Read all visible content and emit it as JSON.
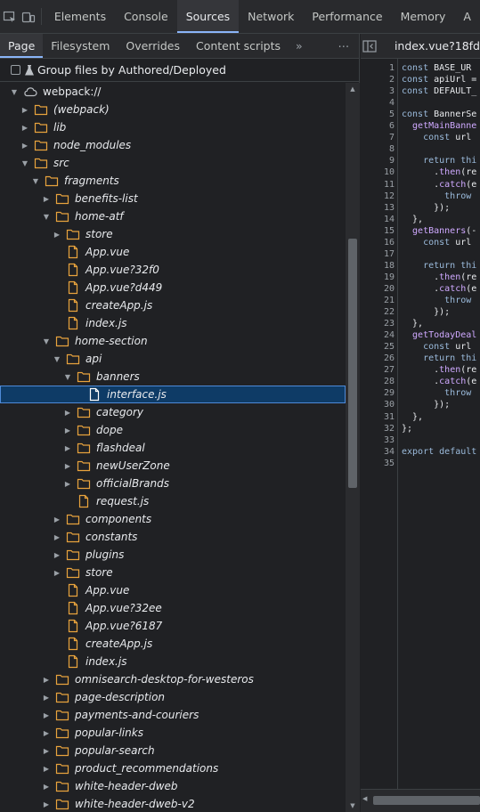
{
  "main_tabs": [
    "Elements",
    "Console",
    "Sources",
    "Network",
    "Performance",
    "Memory",
    "A"
  ],
  "active_main_tab": "Sources",
  "sub_tabs": [
    "Page",
    "Filesystem",
    "Overrides",
    "Content scripts"
  ],
  "sub_tab_more": "»",
  "sub_tab_menu": "⋯",
  "group_label": "Group files by Authored/Deployed",
  "tree": [
    {
      "label": "webpack://",
      "depth": 1,
      "type": "cloud",
      "arrow": "down",
      "italic": false
    },
    {
      "label": "(webpack)",
      "depth": 2,
      "type": "folder",
      "arrow": "right",
      "italic": true
    },
    {
      "label": "lib",
      "depth": 2,
      "type": "folder",
      "arrow": "right",
      "italic": true
    },
    {
      "label": "node_modules",
      "depth": 2,
      "type": "folder",
      "arrow": "right",
      "italic": true
    },
    {
      "label": "src",
      "depth": 2,
      "type": "folder",
      "arrow": "down",
      "italic": true
    },
    {
      "label": "fragments",
      "depth": 3,
      "type": "folder",
      "arrow": "down",
      "italic": true
    },
    {
      "label": "benefits-list",
      "depth": 4,
      "type": "folder",
      "arrow": "right",
      "italic": true
    },
    {
      "label": "home-atf",
      "depth": 4,
      "type": "folder",
      "arrow": "down",
      "italic": true
    },
    {
      "label": "store",
      "depth": 5,
      "type": "folder",
      "arrow": "right",
      "italic": true
    },
    {
      "label": "App.vue",
      "depth": 5,
      "type": "file",
      "arrow": "none",
      "italic": true
    },
    {
      "label": "App.vue?32f0",
      "depth": 5,
      "type": "file",
      "arrow": "none",
      "italic": true
    },
    {
      "label": "App.vue?d449",
      "depth": 5,
      "type": "file",
      "arrow": "none",
      "italic": true
    },
    {
      "label": "createApp.js",
      "depth": 5,
      "type": "file",
      "arrow": "none",
      "italic": true
    },
    {
      "label": "index.js",
      "depth": 5,
      "type": "file",
      "arrow": "none",
      "italic": true
    },
    {
      "label": "home-section",
      "depth": 4,
      "type": "folder",
      "arrow": "down",
      "italic": true
    },
    {
      "label": "api",
      "depth": 5,
      "type": "folder",
      "arrow": "down",
      "italic": true
    },
    {
      "label": "banners",
      "depth": 6,
      "type": "folder",
      "arrow": "down",
      "italic": true
    },
    {
      "label": "interface.js",
      "depth": 7,
      "type": "file-white",
      "arrow": "none",
      "italic": true,
      "selected": true
    },
    {
      "label": "category",
      "depth": 6,
      "type": "folder",
      "arrow": "right",
      "italic": true
    },
    {
      "label": "dope",
      "depth": 6,
      "type": "folder",
      "arrow": "right",
      "italic": true
    },
    {
      "label": "flashdeal",
      "depth": 6,
      "type": "folder",
      "arrow": "right",
      "italic": true
    },
    {
      "label": "newUserZone",
      "depth": 6,
      "type": "folder",
      "arrow": "right",
      "italic": true
    },
    {
      "label": "officialBrands",
      "depth": 6,
      "type": "folder",
      "arrow": "right",
      "italic": true
    },
    {
      "label": "request.js",
      "depth": 6,
      "type": "file",
      "arrow": "none",
      "italic": true
    },
    {
      "label": "components",
      "depth": 5,
      "type": "folder",
      "arrow": "right",
      "italic": true
    },
    {
      "label": "constants",
      "depth": 5,
      "type": "folder",
      "arrow": "right",
      "italic": true
    },
    {
      "label": "plugins",
      "depth": 5,
      "type": "folder",
      "arrow": "right",
      "italic": true
    },
    {
      "label": "store",
      "depth": 5,
      "type": "folder",
      "arrow": "right",
      "italic": true
    },
    {
      "label": "App.vue",
      "depth": 5,
      "type": "file",
      "arrow": "none",
      "italic": true
    },
    {
      "label": "App.vue?32ee",
      "depth": 5,
      "type": "file",
      "arrow": "none",
      "italic": true
    },
    {
      "label": "App.vue?6187",
      "depth": 5,
      "type": "file",
      "arrow": "none",
      "italic": true
    },
    {
      "label": "createApp.js",
      "depth": 5,
      "type": "file",
      "arrow": "none",
      "italic": true
    },
    {
      "label": "index.js",
      "depth": 5,
      "type": "file",
      "arrow": "none",
      "italic": true
    },
    {
      "label": "omnisearch-desktop-for-westeros",
      "depth": 4,
      "type": "folder",
      "arrow": "right",
      "italic": true
    },
    {
      "label": "page-description",
      "depth": 4,
      "type": "folder",
      "arrow": "right",
      "italic": true
    },
    {
      "label": "payments-and-couriers",
      "depth": 4,
      "type": "folder",
      "arrow": "right",
      "italic": true
    },
    {
      "label": "popular-links",
      "depth": 4,
      "type": "folder",
      "arrow": "right",
      "italic": true
    },
    {
      "label": "popular-search",
      "depth": 4,
      "type": "folder",
      "arrow": "right",
      "italic": true
    },
    {
      "label": "product_recommendations",
      "depth": 4,
      "type": "folder",
      "arrow": "right",
      "italic": true
    },
    {
      "label": "white-header-dweb",
      "depth": 4,
      "type": "folder",
      "arrow": "right",
      "italic": true
    },
    {
      "label": "white-header-dweb-v2",
      "depth": 4,
      "type": "folder",
      "arrow": "right",
      "italic": true
    }
  ],
  "editor": {
    "file_tab": "index.vue?18fd",
    "lines": [
      {
        "n": "1",
        "segs": [
          [
            "kw",
            "const "
          ],
          [
            "id",
            "BASE_UR"
          ]
        ]
      },
      {
        "n": "2",
        "segs": [
          [
            "kw",
            "const "
          ],
          [
            "id",
            "apiUrl ="
          ]
        ]
      },
      {
        "n": "3",
        "segs": [
          [
            "kw",
            "const "
          ],
          [
            "id",
            "DEFAULT_"
          ]
        ]
      },
      {
        "n": "4",
        "segs": []
      },
      {
        "n": "5",
        "segs": [
          [
            "kw",
            "const "
          ],
          [
            "id",
            "BannerSe"
          ]
        ]
      },
      {
        "n": "6",
        "segs": [
          [
            "fn",
            "  getMainBanne"
          ]
        ]
      },
      {
        "n": "7",
        "segs": [
          [
            "kw",
            "    const "
          ],
          [
            "id",
            "url"
          ]
        ]
      },
      {
        "n": "8",
        "segs": []
      },
      {
        "n": "9",
        "segs": [
          [
            "kw",
            "    return "
          ],
          [
            "kw",
            "thi"
          ]
        ]
      },
      {
        "n": "10",
        "segs": [
          [
            "id",
            "      ."
          ],
          [
            "fn",
            "then"
          ],
          [
            "id",
            "(re"
          ]
        ]
      },
      {
        "n": "11",
        "segs": [
          [
            "id",
            "      ."
          ],
          [
            "fn",
            "catch"
          ],
          [
            "id",
            "(e"
          ]
        ]
      },
      {
        "n": "12",
        "segs": [
          [
            "kw",
            "        throw"
          ]
        ]
      },
      {
        "n": "13",
        "segs": [
          [
            "id",
            "      });"
          ]
        ]
      },
      {
        "n": "14",
        "segs": [
          [
            "id",
            "  },"
          ]
        ]
      },
      {
        "n": "15",
        "segs": [
          [
            "fn",
            "  getBanners"
          ],
          [
            "id",
            "(-"
          ]
        ]
      },
      {
        "n": "16",
        "segs": [
          [
            "kw",
            "    const "
          ],
          [
            "id",
            "url"
          ]
        ]
      },
      {
        "n": "17",
        "segs": []
      },
      {
        "n": "18",
        "segs": [
          [
            "kw",
            "    return "
          ],
          [
            "kw",
            "thi"
          ]
        ]
      },
      {
        "n": "19",
        "segs": [
          [
            "id",
            "      ."
          ],
          [
            "fn",
            "then"
          ],
          [
            "id",
            "(re"
          ]
        ]
      },
      {
        "n": "20",
        "segs": [
          [
            "id",
            "      ."
          ],
          [
            "fn",
            "catch"
          ],
          [
            "id",
            "(e"
          ]
        ]
      },
      {
        "n": "21",
        "segs": [
          [
            "kw",
            "        throw"
          ]
        ]
      },
      {
        "n": "22",
        "segs": [
          [
            "id",
            "      });"
          ]
        ]
      },
      {
        "n": "23",
        "segs": [
          [
            "id",
            "  },"
          ]
        ]
      },
      {
        "n": "24",
        "segs": [
          [
            "fn",
            "  getTodayDeal"
          ]
        ]
      },
      {
        "n": "25",
        "segs": [
          [
            "kw",
            "    const "
          ],
          [
            "id",
            "url"
          ]
        ]
      },
      {
        "n": "26",
        "segs": [
          [
            "kw",
            "    return "
          ],
          [
            "kw",
            "thi"
          ]
        ]
      },
      {
        "n": "27",
        "segs": [
          [
            "id",
            "      ."
          ],
          [
            "fn",
            "then"
          ],
          [
            "id",
            "(re"
          ]
        ]
      },
      {
        "n": "28",
        "segs": [
          [
            "id",
            "      ."
          ],
          [
            "fn",
            "catch"
          ],
          [
            "id",
            "(e"
          ]
        ]
      },
      {
        "n": "29",
        "segs": [
          [
            "kw",
            "        throw"
          ]
        ]
      },
      {
        "n": "30",
        "segs": [
          [
            "id",
            "      });"
          ]
        ]
      },
      {
        "n": "31",
        "segs": [
          [
            "id",
            "  },"
          ]
        ]
      },
      {
        "n": "32",
        "segs": [
          [
            "id",
            "};"
          ]
        ]
      },
      {
        "n": "33",
        "segs": []
      },
      {
        "n": "34",
        "segs": [
          [
            "kw",
            "export "
          ],
          [
            "kw",
            "default"
          ]
        ]
      },
      {
        "n": "35",
        "segs": []
      }
    ]
  },
  "colors": {
    "folder": "#e8a33d",
    "file": "#e8a33d",
    "file_selected": "#ffffff",
    "keyword": "#9bbbdc",
    "function": "#cfa9ff",
    "identifier": "#e8eaed",
    "accent": "#8ab4f8",
    "selection": "#0e3b66"
  }
}
